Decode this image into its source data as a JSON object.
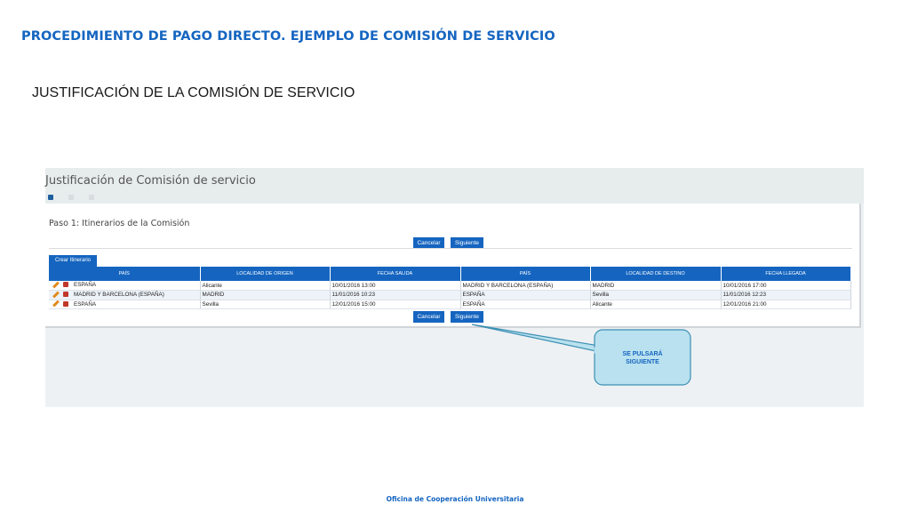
{
  "slide": {
    "title": "PROCEDIMIENTO DE PAGO DIRECTO. EJEMPLO DE COMISIÓN DE SERVICIO",
    "subtitle": "JUSTIFICACIÓN DE LA COMISIÓN DE SERVICIO",
    "footer": "Oficina de Cooperación Universitaria"
  },
  "app": {
    "header_title": "Justificación de Comisión de servicio",
    "step_label": "Paso 1: Itinerarios de la Comisión",
    "buttons": {
      "cancel": "Cancelar",
      "next": "Siguiente"
    },
    "tab_label": "Crear Itinerario",
    "table": {
      "columns": [
        "PAÍS",
        "LOCALIDAD DE ORIGEN",
        "FECHA SALIDA",
        "PAÍS",
        "LOCALIDAD DE DESTINO",
        "FECHA LLEGADA"
      ],
      "rows": [
        [
          "ESPAÑA",
          "Alicante",
          "10/01/2016 13:00",
          "MADRID Y BARCELONA (ESPAÑA)",
          "MADRID",
          "10/01/2016 17:00"
        ],
        [
          "MADRID Y BARCELONA (ESPAÑA)",
          "MADRID",
          "11/01/2016 10:23",
          "ESPAÑA",
          "Sevilla",
          "11/01/2016 12:23"
        ],
        [
          "ESPAÑA",
          "Sevilla",
          "12/01/2016 15:00",
          "ESPAÑA",
          "Alicante",
          "12/01/2016 21:00"
        ]
      ]
    }
  },
  "callout": {
    "text": "SE PULSARÁ\nSIGUIENTE",
    "fill": "#b9e1ef",
    "border": "#3b8fb3"
  },
  "colors": {
    "accent": "#1565c0",
    "title_blue": "#1565c0"
  }
}
